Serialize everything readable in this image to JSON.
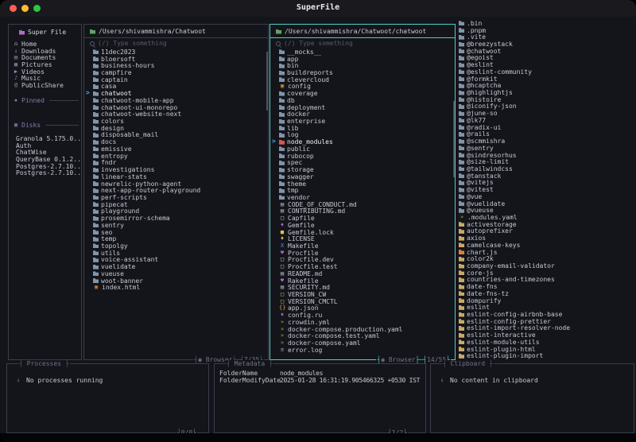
{
  "colors": {
    "accent": "#4fd0bd",
    "border": "#3a3e4b",
    "background": "#14151b",
    "arrow": "#3bb7e0"
  },
  "chrome": {
    "tab_l": "┤",
    "tab_r": "├",
    "join": "├─┤",
    "arrow": ">",
    "eye": "◉"
  },
  "window": {
    "title": "SuperFile",
    "traffic_lights": [
      "#ff5f57",
      "#febc2e",
      "#28c840"
    ]
  },
  "sidebar": {
    "title": "Super File",
    "items": [
      {
        "name": "Home",
        "icon": "home"
      },
      {
        "name": "Downloads",
        "icon": "downloads"
      },
      {
        "name": "Documents",
        "icon": "documents"
      },
      {
        "name": "Pictures",
        "icon": "pictures"
      },
      {
        "name": "Videos",
        "icon": "videos"
      },
      {
        "name": "Music",
        "icon": "music"
      },
      {
        "name": "PublicShare",
        "icon": "globe"
      }
    ],
    "pinned_label": "Pinned",
    "disks_label": "Disks",
    "disks": [
      "Granola 5.175.0...",
      "Auth",
      "ChatWise",
      "QueryBase 0.1.2...",
      "Postgres-2.7.10...",
      "Postgres-2.7.10..."
    ]
  },
  "panels": [
    {
      "path": "/Users/shivammishra/Chatwoot",
      "search_placeholder": "(/) Type something",
      "footer_mode": "Browser",
      "footer_count": "7/35",
      "files": [
        {
          "name": "11dec2023",
          "icon": "folder"
        },
        {
          "name": "bloersoft",
          "icon": "folder"
        },
        {
          "name": "business-hours",
          "icon": "folder"
        },
        {
          "name": "campfire",
          "icon": "folder"
        },
        {
          "name": "captain",
          "icon": "folder"
        },
        {
          "name": "casa",
          "icon": "folder"
        },
        {
          "name": "chatwoot",
          "icon": "folder",
          "selected": true
        },
        {
          "name": "chatwoot-mobile-app",
          "icon": "folder"
        },
        {
          "name": "chatwoot-ui-monorepo",
          "icon": "folder"
        },
        {
          "name": "chatwoot-website-next",
          "icon": "folder"
        },
        {
          "name": "colors",
          "icon": "folder"
        },
        {
          "name": "design",
          "icon": "folder"
        },
        {
          "name": "disposable_mail",
          "icon": "folder"
        },
        {
          "name": "docs",
          "icon": "folder"
        },
        {
          "name": "emissive",
          "icon": "folder"
        },
        {
          "name": "entropy",
          "icon": "folder"
        },
        {
          "name": "fndr",
          "icon": "folder"
        },
        {
          "name": "investigations",
          "icon": "folder"
        },
        {
          "name": "linear-stats",
          "icon": "folder"
        },
        {
          "name": "newrelic-python-agent",
          "icon": "folder"
        },
        {
          "name": "next-app-router-playground",
          "icon": "folder"
        },
        {
          "name": "perf-scripts",
          "icon": "folder"
        },
        {
          "name": "pipecat",
          "icon": "folder"
        },
        {
          "name": "playground",
          "icon": "folder"
        },
        {
          "name": "prosemirror-schema",
          "icon": "folder"
        },
        {
          "name": "sentry",
          "icon": "folder"
        },
        {
          "name": "seo",
          "icon": "folder"
        },
        {
          "name": "temp",
          "icon": "folder"
        },
        {
          "name": "topolgy",
          "icon": "folder"
        },
        {
          "name": "utils",
          "icon": "folder"
        },
        {
          "name": "voice-assistant",
          "icon": "folder"
        },
        {
          "name": "vuelidate",
          "icon": "folder"
        },
        {
          "name": "vueuse",
          "icon": "folder"
        },
        {
          "name": "woot-banner",
          "icon": "folder"
        },
        {
          "name": "index.html",
          "icon": "html"
        }
      ]
    },
    {
      "path": "/Users/shivammishra/Chatwoot/chatwoot",
      "search_placeholder": "(/) Type something",
      "footer_mode": "Browser",
      "footer_count": "14/55",
      "files": [
        {
          "name": "__mocks__",
          "icon": "folder"
        },
        {
          "name": "app",
          "icon": "folder"
        },
        {
          "name": "bin",
          "icon": "folder"
        },
        {
          "name": "buildreports",
          "icon": "folder"
        },
        {
          "name": "clevercloud",
          "icon": "folder"
        },
        {
          "name": "config",
          "icon": "gear"
        },
        {
          "name": "coverage",
          "icon": "folder"
        },
        {
          "name": "db",
          "icon": "folder"
        },
        {
          "name": "deployment",
          "icon": "folder"
        },
        {
          "name": "docker",
          "icon": "folder"
        },
        {
          "name": "enterprise",
          "icon": "folder"
        },
        {
          "name": "lib",
          "icon": "folder"
        },
        {
          "name": "log",
          "icon": "folder"
        },
        {
          "name": "node_modules",
          "icon": "folder-red",
          "selected": true
        },
        {
          "name": "public",
          "icon": "folder"
        },
        {
          "name": "rubocop",
          "icon": "folder"
        },
        {
          "name": "spec",
          "icon": "folder"
        },
        {
          "name": "storage",
          "icon": "folder"
        },
        {
          "name": "swagger",
          "icon": "folder"
        },
        {
          "name": "theme",
          "icon": "folder"
        },
        {
          "name": "tmp",
          "icon": "folder"
        },
        {
          "name": "vendor",
          "icon": "folder"
        },
        {
          "name": "CODE_OF_CONDUCT.md",
          "icon": "markdown"
        },
        {
          "name": "CONTRIBUTING.md",
          "icon": "markdown"
        },
        {
          "name": "Capfile",
          "icon": "file"
        },
        {
          "name": "Gemfile",
          "icon": "gem"
        },
        {
          "name": "Gemfile.lock",
          "icon": "lock"
        },
        {
          "name": "LICENSE",
          "icon": "key"
        },
        {
          "name": "Makefile",
          "icon": "make"
        },
        {
          "name": "Procfile",
          "icon": "heart"
        },
        {
          "name": "Procfile.dev",
          "icon": "file"
        },
        {
          "name": "Procfile.test",
          "icon": "file"
        },
        {
          "name": "README.md",
          "icon": "markdown"
        },
        {
          "name": "Rakefile",
          "icon": "heart"
        },
        {
          "name": "SECURITY.md",
          "icon": "markdown"
        },
        {
          "name": "VERSION_CW",
          "icon": "file-yellow"
        },
        {
          "name": "VERSION_CMCTL",
          "icon": "file-yellow"
        },
        {
          "name": "app.json",
          "icon": "json"
        },
        {
          "name": "config.ru",
          "icon": "gem"
        },
        {
          "name": "crowdin.yml",
          "icon": "yaml"
        },
        {
          "name": "docker-compose.production.yaml",
          "icon": "yaml"
        },
        {
          "name": "docker-compose.test.yaml",
          "icon": "yaml"
        },
        {
          "name": "docker-compose.yaml",
          "icon": "yaml"
        },
        {
          "name": "error.log",
          "icon": "log"
        }
      ]
    }
  ],
  "preview": {
    "files": [
      {
        "name": ".bin",
        "icon": "folder"
      },
      {
        "name": ".pnpm",
        "icon": "folder"
      },
      {
        "name": ".vite",
        "icon": "folder"
      },
      {
        "name": "@breezystack",
        "icon": "folder"
      },
      {
        "name": "@chatwoot",
        "icon": "folder"
      },
      {
        "name": "@egoist",
        "icon": "folder"
      },
      {
        "name": "@eslint",
        "icon": "folder"
      },
      {
        "name": "@eslint-community",
        "icon": "folder"
      },
      {
        "name": "@formkit",
        "icon": "folder"
      },
      {
        "name": "@hcaptcha",
        "icon": "folder"
      },
      {
        "name": "@highlightjs",
        "icon": "folder"
      },
      {
        "name": "@histoire",
        "icon": "folder"
      },
      {
        "name": "@iconify-json",
        "icon": "folder"
      },
      {
        "name": "@june-so",
        "icon": "folder"
      },
      {
        "name": "@lk77",
        "icon": "folder"
      },
      {
        "name": "@radix-ui",
        "icon": "folder"
      },
      {
        "name": "@rails",
        "icon": "folder"
      },
      {
        "name": "@scmmishra",
        "icon": "folder"
      },
      {
        "name": "@sentry",
        "icon": "folder"
      },
      {
        "name": "@sindresorhus",
        "icon": "folder"
      },
      {
        "name": "@size-limit",
        "icon": "folder"
      },
      {
        "name": "@tailwindcss",
        "icon": "folder"
      },
      {
        "name": "@tanstack",
        "icon": "folder"
      },
      {
        "name": "@vitejs",
        "icon": "folder"
      },
      {
        "name": "@vitest",
        "icon": "folder"
      },
      {
        "name": "@vue",
        "icon": "folder"
      },
      {
        "name": "@vuelidate",
        "icon": "folder"
      },
      {
        "name": "@vueuse",
        "icon": "folder"
      },
      {
        "name": ".modules.yaml",
        "icon": "yaml"
      },
      {
        "name": "activestorage",
        "icon": "package"
      },
      {
        "name": "autoprefixer",
        "icon": "package"
      },
      {
        "name": "axios",
        "icon": "package"
      },
      {
        "name": "camelcase-keys",
        "icon": "package"
      },
      {
        "name": "chart.js",
        "icon": "folder-orange"
      },
      {
        "name": "color2k",
        "icon": "package"
      },
      {
        "name": "company-email-validator",
        "icon": "package"
      },
      {
        "name": "core-js",
        "icon": "package"
      },
      {
        "name": "countries-and-timezones",
        "icon": "package"
      },
      {
        "name": "date-fns",
        "icon": "package"
      },
      {
        "name": "date-fns-tz",
        "icon": "package"
      },
      {
        "name": "dompurify",
        "icon": "package"
      },
      {
        "name": "eslint",
        "icon": "package"
      },
      {
        "name": "eslint-config-airbnb-base",
        "icon": "package"
      },
      {
        "name": "eslint-config-prettier",
        "icon": "package"
      },
      {
        "name": "eslint-import-resolver-node",
        "icon": "package"
      },
      {
        "name": "eslint-interactive",
        "icon": "package"
      },
      {
        "name": "eslint-module-utils",
        "icon": "package"
      },
      {
        "name": "eslint-plugin-html",
        "icon": "package"
      },
      {
        "name": "eslint-plugin-import",
        "icon": "package"
      }
    ]
  },
  "bottom": {
    "processes": {
      "title": "Processes",
      "empty": "No processes running",
      "counter": "0/0"
    },
    "metadata": {
      "title": "Metadata",
      "counter": "1/2",
      "rows": [
        {
          "label": "FolderName",
          "value": "node_modules"
        },
        {
          "label": "FolderModifyDate",
          "value": "2025-01-28 16:31:19.905466325 +0530 IST"
        }
      ]
    },
    "clipboard": {
      "title": "Clipboard",
      "empty": "No content in clipboard"
    }
  },
  "icon_styles": {
    "folder": {
      "shape": "folder",
      "color": "#8294a8"
    },
    "folder-red": {
      "shape": "folder",
      "color": "#d95757"
    },
    "folder-purple": {
      "shape": "folder",
      "color": "#b06bc9"
    },
    "folder-green": {
      "shape": "folder",
      "color": "#5fa463"
    },
    "folder-orange": {
      "shape": "folder",
      "color": "#d9823f"
    },
    "package": {
      "shape": "folder",
      "color": "#c9a96a"
    },
    "gear": {
      "glyph": "▣",
      "color": "#d9913f"
    },
    "markdown": {
      "glyph": "▤",
      "color": "#b8bec9"
    },
    "file": {
      "glyph": "□",
      "color": "#c6cbd4"
    },
    "file-yellow": {
      "glyph": "□",
      "color": "#d8c07a"
    },
    "gem": {
      "glyph": "♦",
      "color": "#a96bd0"
    },
    "lock": {
      "glyph": "■",
      "color": "#e3c24e"
    },
    "key": {
      "glyph": "♦",
      "color": "#e3c24e"
    },
    "make": {
      "glyph": "X",
      "color": "#4d9fe0"
    },
    "heart": {
      "glyph": "♥",
      "color": "#b16bc9"
    },
    "json": {
      "glyph": "{}",
      "color": "#e0a33c"
    },
    "yaml": {
      "glyph": "»",
      "color": "#b5a33a"
    },
    "log": {
      "glyph": "≡",
      "color": "#9aa0ac"
    },
    "html": {
      "glyph": "▣",
      "color": "#d9823f"
    },
    "home": {
      "glyph": "⌂",
      "color": "#c3c8d2"
    },
    "downloads": {
      "glyph": "↓",
      "color": "#8294a8"
    },
    "documents": {
      "glyph": "▤",
      "color": "#8294a8"
    },
    "pictures": {
      "glyph": "▦",
      "color": "#8294a8"
    },
    "videos": {
      "glyph": "▶",
      "color": "#8294a8"
    },
    "music": {
      "glyph": "♪",
      "color": "#8294a8"
    },
    "globe": {
      "glyph": "@",
      "color": "#8294a8"
    },
    "pin": {
      "glyph": "▪",
      "color": "#837caa"
    },
    "disk": {
      "glyph": "▣",
      "color": "#837caa"
    },
    "tray": {
      "glyph": "↓",
      "color": "#8a90a0"
    }
  }
}
